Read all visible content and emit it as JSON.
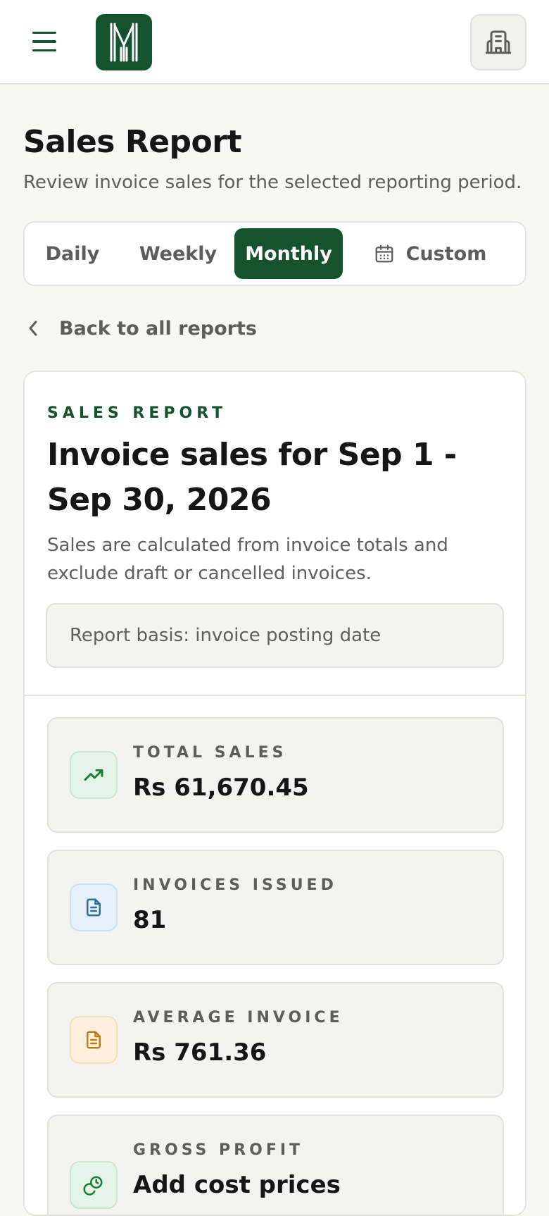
{
  "header": {
    "menu_icon": "hamburger-menu-icon",
    "logo_icon": "brand-logo",
    "store_icon": "building-icon",
    "brand_color": "#14532d"
  },
  "page": {
    "title": "Sales Report",
    "subtitle": "Review invoice sales for the selected reporting period."
  },
  "period_tabs": {
    "daily": "Daily",
    "weekly": "Weekly",
    "monthly": "Monthly",
    "custom": "Custom",
    "selected": "Monthly",
    "custom_icon": "calendar-icon"
  },
  "back_link": {
    "label": "Back to all reports",
    "icon": "chevron-left-icon"
  },
  "report": {
    "eyebrow": "SALES REPORT",
    "title": "Invoice sales for Sep 1 - Sep 30, 2026",
    "description": "Sales are calculated from invoice totals and exclude draft or cancelled invoices.",
    "basis": "Report basis: invoice posting date"
  },
  "metrics": [
    {
      "label": "TOTAL SALES",
      "value": "Rs 61,670.45",
      "icon": "trending-up-icon",
      "accent": "#1f7a3b"
    },
    {
      "label": "INVOICES ISSUED",
      "value": "81",
      "icon": "document-icon",
      "accent": "#2f6d99"
    },
    {
      "label": "AVERAGE INVOICE",
      "value": "Rs 761.36",
      "icon": "document-icon",
      "accent": "#c27a1a"
    },
    {
      "label": "GROSS PROFIT",
      "value": "Add cost prices",
      "icon": "coins-icon",
      "accent": "#1f7a3b"
    }
  ]
}
